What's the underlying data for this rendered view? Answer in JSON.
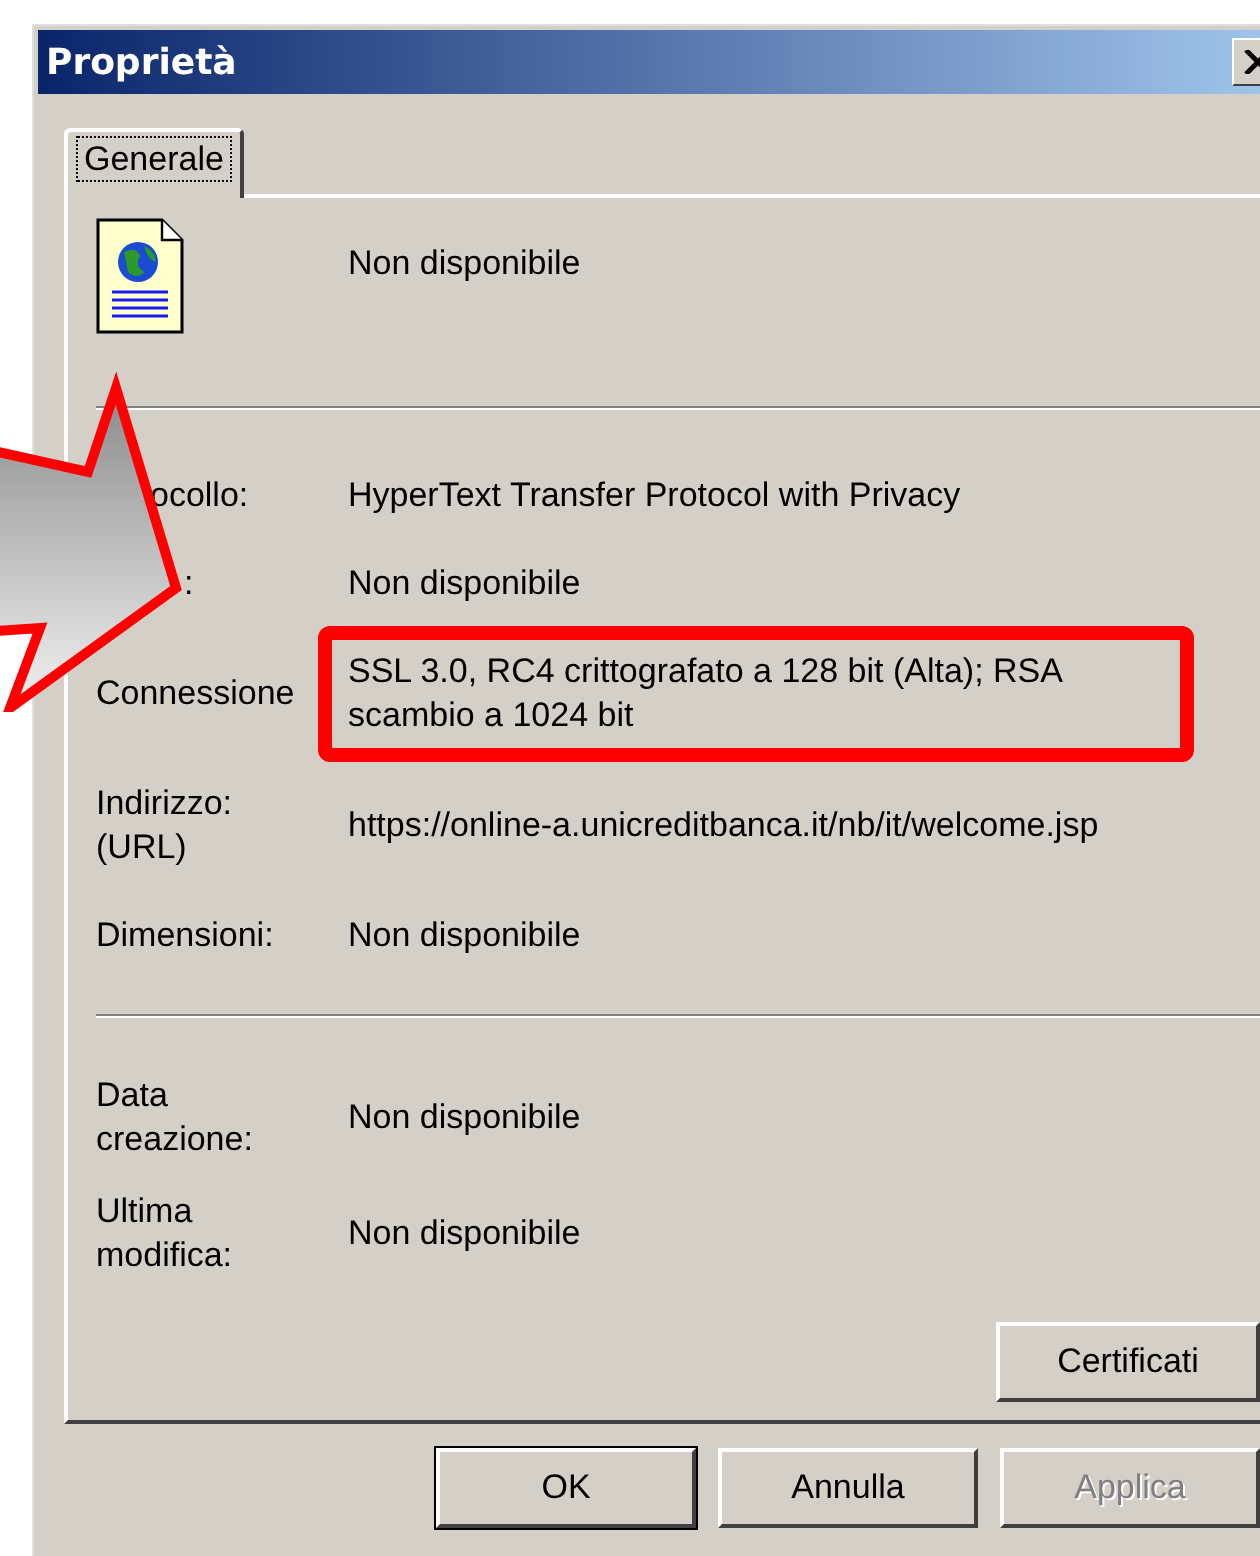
{
  "window": {
    "title": "Proprietà"
  },
  "tabs": [
    {
      "label": "Generale",
      "selected": true
    }
  ],
  "header": {
    "value": "Non disponibile"
  },
  "sections": [
    {
      "rows": [
        {
          "label": "ocollo:",
          "value": "HyperText Transfer Protocol with Privacy",
          "highlighted": false
        },
        {
          "label": ":",
          "value": "Non disponibile",
          "highlighted": false
        },
        {
          "label": "Connessione",
          "value": "SSL 3.0, RC4 crittografato a 128 bit (Alta); RSA scambio a 1024 bit",
          "highlighted": true
        },
        {
          "label": "Indirizzo: (URL)",
          "value": "https://online-a.unicreditbanca.it/nb/it/welcome.jsp",
          "highlighted": false
        },
        {
          "label": "Dimensioni:",
          "value": "Non disponibile",
          "highlighted": false
        }
      ]
    },
    {
      "rows": [
        {
          "label": "Data creazione:",
          "value": "Non disponibile",
          "highlighted": false
        },
        {
          "label": "Ultima modifica:",
          "value": "Non disponibile",
          "highlighted": false
        }
      ]
    }
  ],
  "panel_button": {
    "label": "Certificati",
    "disabled": false
  },
  "buttons": [
    {
      "label": "OK",
      "disabled": false,
      "default": true
    },
    {
      "label": "Annulla",
      "disabled": false,
      "default": false
    },
    {
      "label": "Applica",
      "disabled": true,
      "default": false
    }
  ]
}
